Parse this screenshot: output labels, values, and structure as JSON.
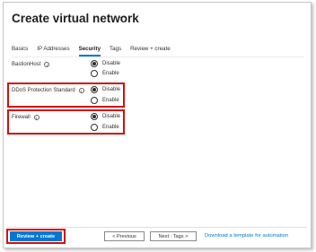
{
  "header": {
    "title": "Create virtual network",
    "more_label": "···"
  },
  "tabs": [
    {
      "label": "Basics",
      "active": false
    },
    {
      "label": "IP Addresses",
      "active": false
    },
    {
      "label": "Security",
      "active": true
    },
    {
      "label": "Tags",
      "active": false
    },
    {
      "label": "Review + create",
      "active": false
    }
  ],
  "settings": {
    "bastion": {
      "label": "BastionHost",
      "info_icon": "info-icon",
      "options": [
        "Disable",
        "Enable"
      ],
      "selected": "Disable"
    },
    "ddos": {
      "label": "DDoS Protection Standard",
      "info_icon": "info-icon",
      "options": [
        "Disable",
        "Enable"
      ],
      "selected": "Disable"
    },
    "firewall": {
      "label": "Firewall",
      "info_icon": "info-icon",
      "options": [
        "Disable",
        "Enable"
      ],
      "selected": "Disable"
    }
  },
  "footer": {
    "review_create_label": "Review + create",
    "previous_label": "< Previous",
    "next_label": "Next : Tags >",
    "download_label": "Download a template for automation"
  },
  "colors": {
    "accent": "#0078d4",
    "highlight": "#d10f0f",
    "text": "#323130"
  }
}
